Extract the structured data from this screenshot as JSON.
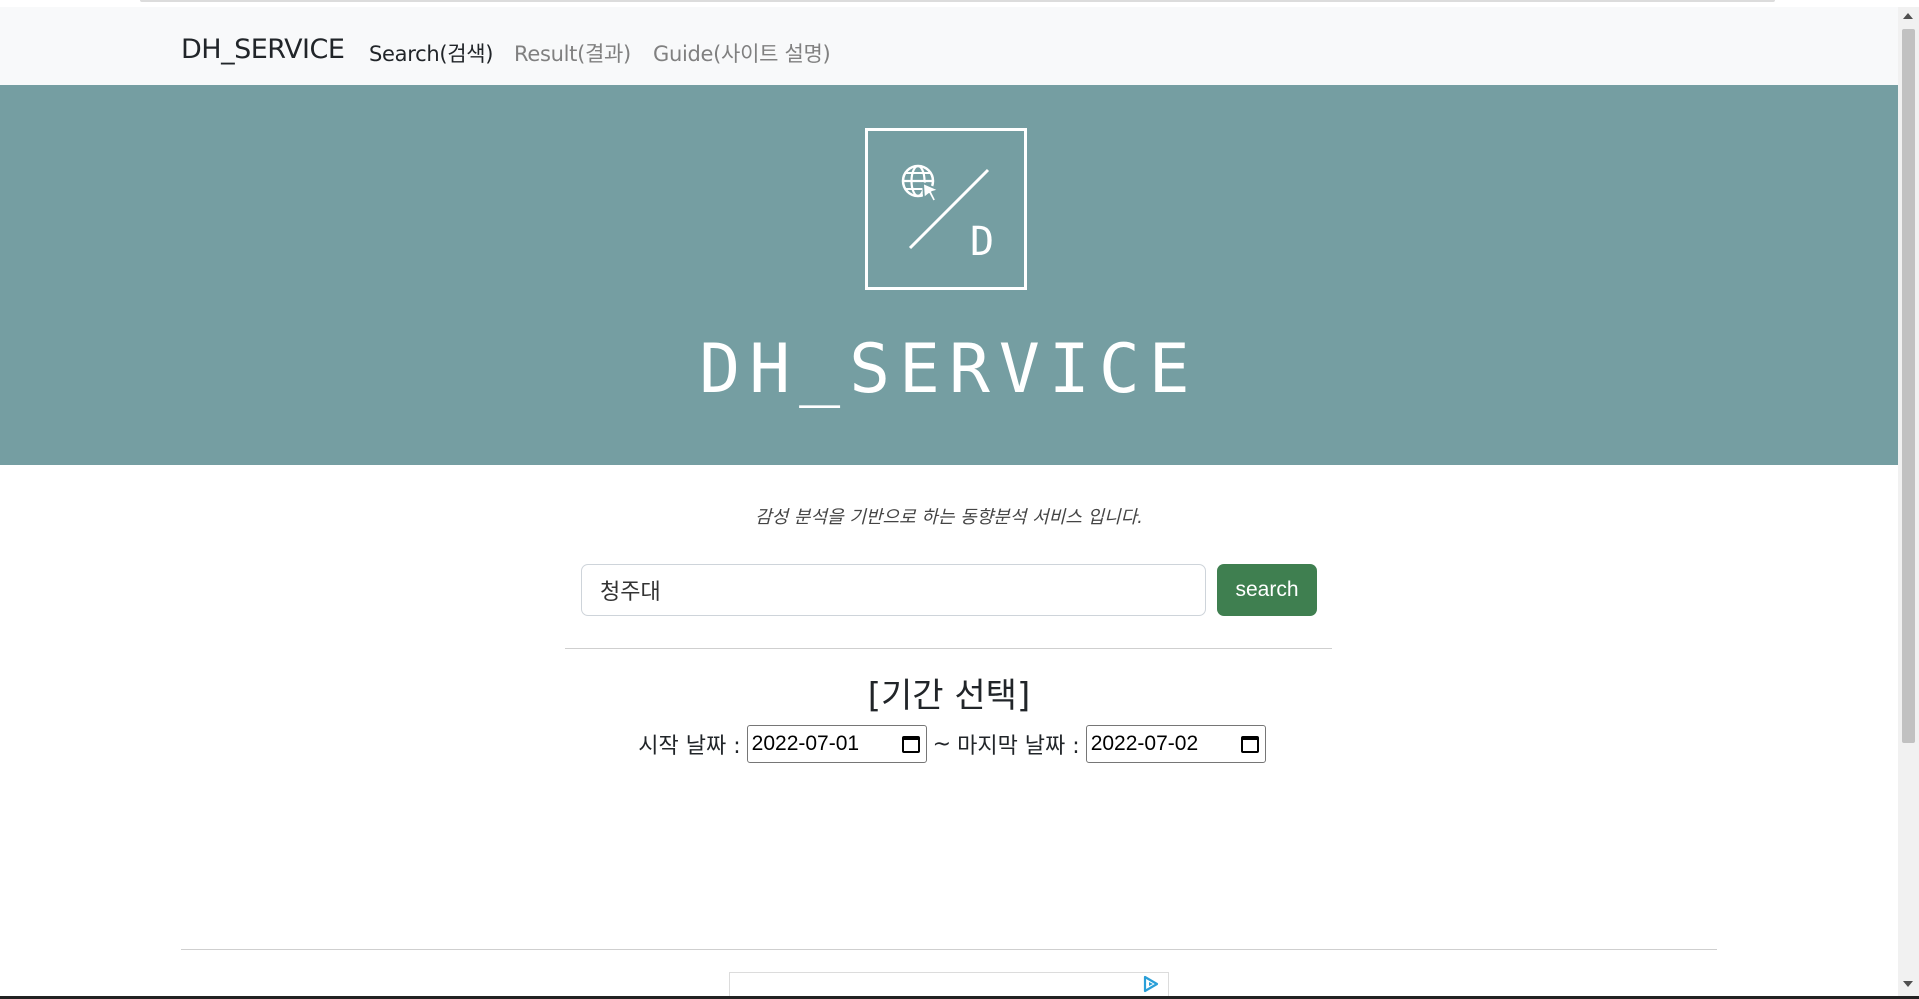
{
  "navbar": {
    "brand": "DH_SERVICE",
    "links": [
      {
        "label": "Search(검색)",
        "active": true
      },
      {
        "label": "Result(결과)",
        "active": false
      },
      {
        "label": "Guide(사이트 설명)",
        "active": false
      }
    ]
  },
  "hero": {
    "logo_letter": "D",
    "logo_icon": "globe-cursor-icon",
    "title": "DH_SERVICE",
    "background": "#759ea2"
  },
  "main": {
    "tagline": "감성 분석을 기반으로 하는 동향분석 서비스 입니다.",
    "search": {
      "value": "청주대",
      "button_label": "search",
      "button_color": "#3f7f50"
    },
    "period": {
      "title": "[기간 선택]",
      "start_label": "시작 날짜 :",
      "start_value": "2022-07-01",
      "separator": "~",
      "end_label": "마지막 날짜 :",
      "end_value": "2022-07-02"
    }
  },
  "footer": {
    "ad_icon": "adchoices-icon"
  }
}
